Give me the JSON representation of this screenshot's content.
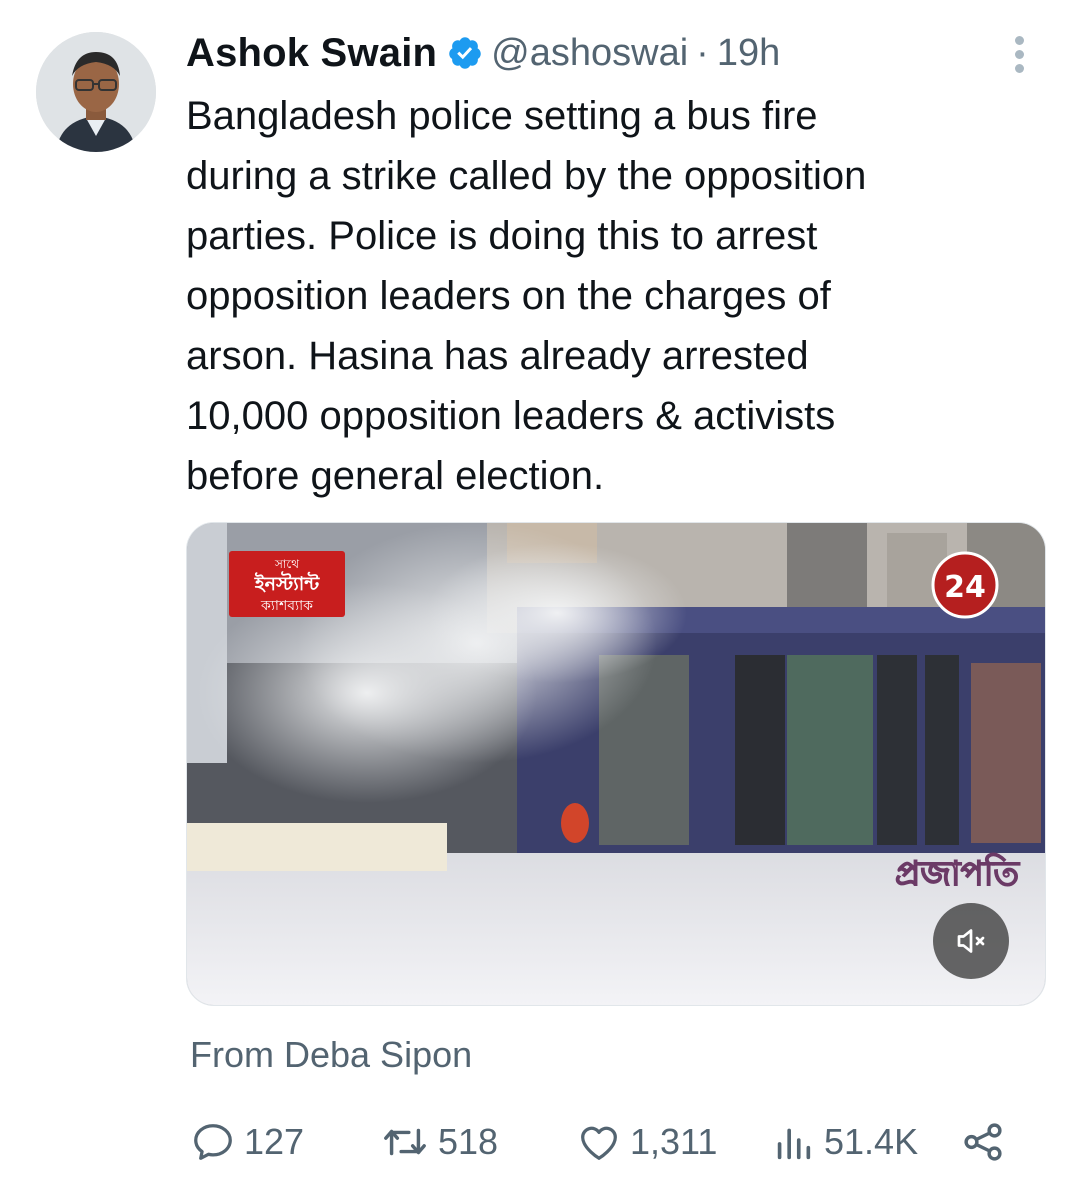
{
  "author": {
    "name": "Ashok Swain",
    "handle": "@ashoswai",
    "separator": "·",
    "time": "19h",
    "verified": true
  },
  "tweet": {
    "lines": [
      "Bangladesh police setting a bus fire",
      "during a strike called by the opposition",
      "parties. Police is doing this to arrest",
      "opposition leaders on the charges of",
      "arson. Hasina has already arrested",
      "10,000 opposition leaders & activists",
      "before general election."
    ]
  },
  "media": {
    "badge_lines": [
      "সাথে",
      "ইনস্ট্যান্ট",
      "ক্যাশব্যাক"
    ],
    "channel_logo": "24",
    "bus_sign": "প্রজাপতি",
    "mute_icon": "speaker-muted-icon",
    "accent": "#c81e1e"
  },
  "source": "From Deba Sipon",
  "actions": {
    "replies": "127",
    "reposts": "518",
    "likes": "1,311",
    "views": "51.4K"
  },
  "colors": {
    "text": "#0f1419",
    "secondary": "#536471",
    "verified": "#1d9bf0"
  }
}
